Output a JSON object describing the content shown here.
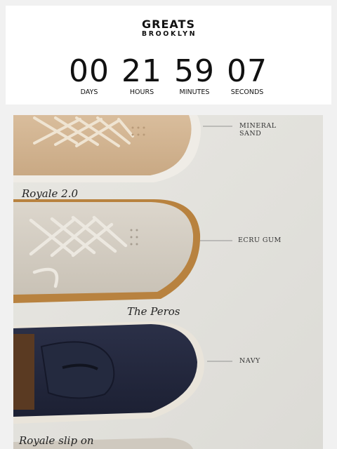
{
  "brand": {
    "line1": "GREATS",
    "line2": "BROOKLYN"
  },
  "countdown": [
    {
      "value": "00",
      "label": "DAYS"
    },
    {
      "value": "21",
      "label": "HOURS"
    },
    {
      "value": "59",
      "label": "MINUTES"
    },
    {
      "value": "07",
      "label": "SECONDS"
    }
  ],
  "hero": {
    "colours": [
      {
        "line1": "MINERAL",
        "line2": "SAND"
      },
      {
        "line1": "ECRU GUM"
      },
      {
        "line1": "NAVY"
      }
    ],
    "models": [
      "Royale 2.0",
      "The Peros",
      "Royale slip on"
    ]
  }
}
